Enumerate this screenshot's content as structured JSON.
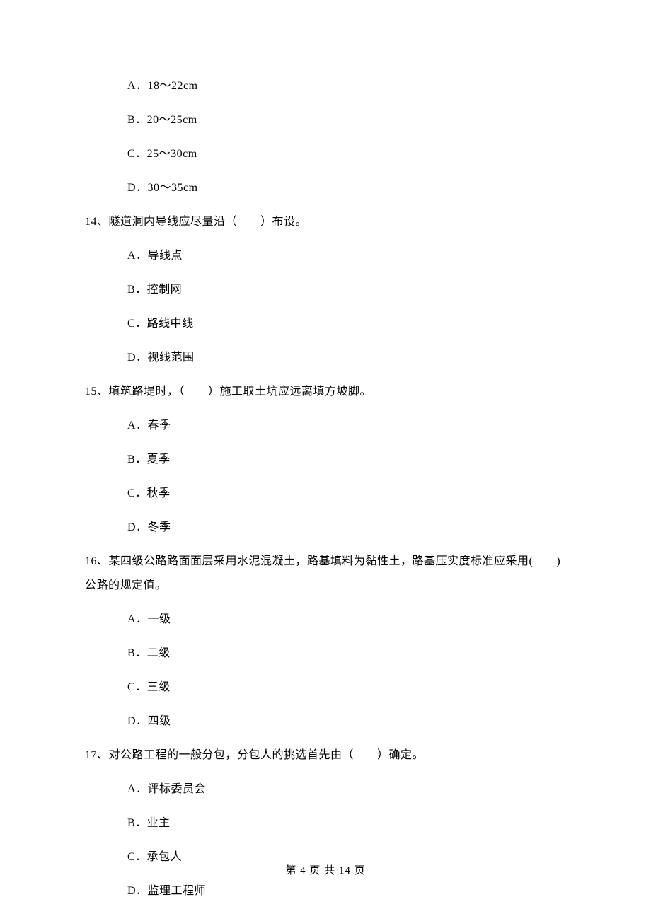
{
  "q13": {
    "options": {
      "A": "A．18～22cm",
      "B": "B．20～25cm",
      "C": "C．25～30cm",
      "D": "D．30～35cm"
    }
  },
  "q14": {
    "stem": "14、隧道洞内导线应尽量沿（　　）布设。",
    "options": {
      "A": "A．导线点",
      "B": "B．控制网",
      "C": "C．路线中线",
      "D": "D．视线范围"
    }
  },
  "q15": {
    "stem": "15、填筑路堤时，（　　）施工取土坑应远离填方坡脚。",
    "options": {
      "A": "A．春季",
      "B": "B．夏季",
      "C": "C．秋季",
      "D": "D．冬季"
    }
  },
  "q16": {
    "stem_line1": "16、某四级公路路面面层采用水泥混凝土，路基填料为黏性土，路基压实度标准应采用(　　)",
    "stem_line2": "公路的规定值。",
    "options": {
      "A": "A．一级",
      "B": "B．二级",
      "C": "C．三级",
      "D": "D．四级"
    }
  },
  "q17": {
    "stem": "17、对公路工程的一般分包，分包人的挑选首先由（　　）确定。",
    "options": {
      "A": "A．评标委员会",
      "B": "B．业主",
      "C": "C．承包人",
      "D": "D．监理工程师"
    }
  },
  "footer": "第 4 页 共 14 页"
}
